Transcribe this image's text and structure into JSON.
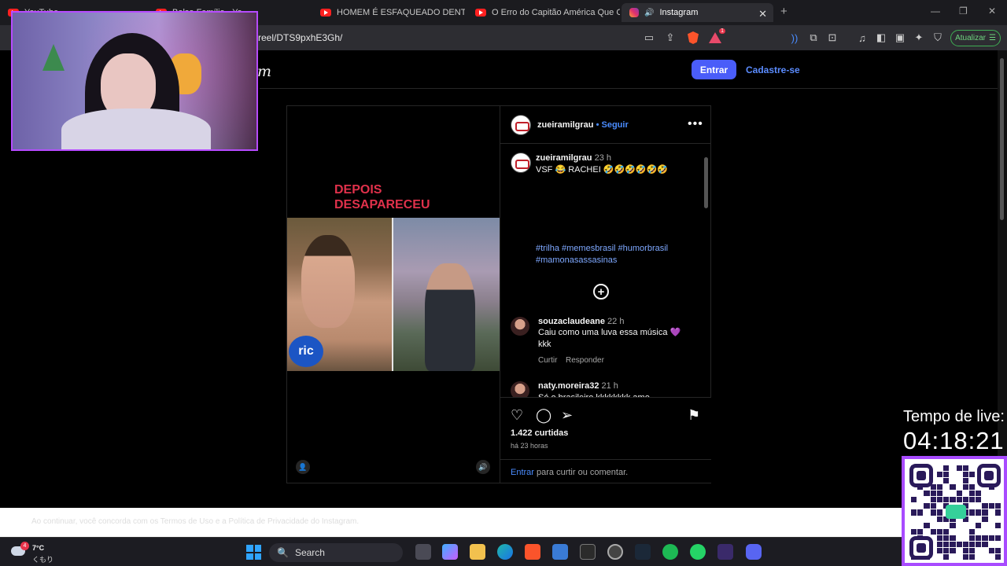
{
  "tabs": [
    {
      "label": "YouTube",
      "icon": "youtube-icon"
    },
    {
      "label": "Bolsa Família - Yo",
      "icon": "youtube-icon"
    },
    {
      "label": "HOMEM É ESFAQUEADO DENTRO D",
      "icon": "youtube-icon"
    },
    {
      "label": "O Erro do Capitão América Que Cric",
      "icon": "youtube-icon"
    },
    {
      "label": "Instagram",
      "icon": "instagram-icon",
      "active": true
    }
  ],
  "address": {
    "url": "reel/DTS9pxhE3Gh/",
    "update_label": "Atualizar",
    "ext_badge": "1"
  },
  "instagram": {
    "logo_tail": "m",
    "login_button": "Entrar",
    "signup_link": "Cadastre-se",
    "post": {
      "video_text_line1": "DEPOIS",
      "video_text_line2": "DESAPARECEU",
      "video_logo": "ric",
      "author": "zueiramilgrau",
      "follow": "• Seguir",
      "caption_author": "zueiramilgrau",
      "caption_time": "23 h",
      "caption": "VSF 😂 RACHEI 🤣🤣🤣🤣🤣🤣",
      "hashtags": "#trilha #memesbrasil #humorbrasil #mamonasassasinas",
      "comments": [
        {
          "user": "souzaclaudeane",
          "time": "22 h",
          "text": "Caiu como uma luva essa música 💜 kkk",
          "like": "Curtir",
          "reply": "Responder"
        },
        {
          "user": "naty.moreira32",
          "time": "21 h",
          "text": "Só o brasileiro kkkkkkkk amo"
        }
      ],
      "likes": "1.422 curtidas",
      "posted": "há 23 horas",
      "login_prompt_link": "Entrar",
      "login_prompt_text": " para curtir ou comentar."
    }
  },
  "cookie_text": "Ao continuar, você concorda com os Termos de Uso e a Política de Privacidade do Instagram.",
  "taskbar": {
    "weather_temp": "7°C",
    "weather_desc": "くもり",
    "weather_badge": "4",
    "search_label": "Search"
  },
  "overlay": {
    "live_label": "Tempo de live:",
    "live_time": "04:18:21"
  },
  "colors": {
    "accent": "#4a5df9",
    "link": "#4a8cff",
    "video_text": "#e0314b",
    "overlay_border": "#a84bff"
  }
}
